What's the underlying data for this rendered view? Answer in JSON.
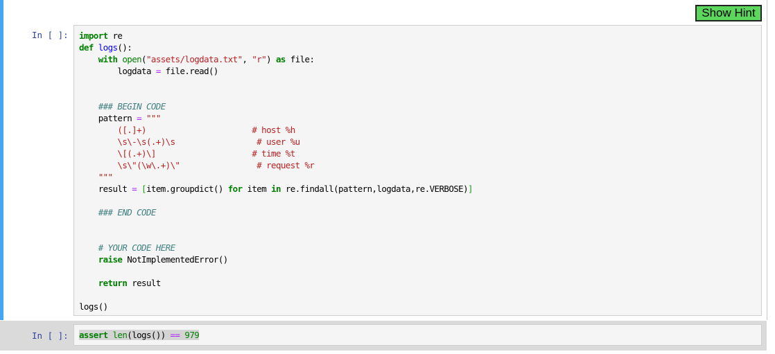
{
  "toolbar": {
    "show_hint_label": "Show Hint"
  },
  "cells": [
    {
      "prompt": "In [ ]:",
      "selected": true,
      "lines": {
        "l1_kw": "import",
        "l1_rest": " re",
        "l2_kw": "def",
        "l2_fn": "logs",
        "l2_rest": "():",
        "l3_kw": "with",
        "l3_bi": "open",
        "l3_p1": "(",
        "l3_s1": "\"assets/logdata.txt\"",
        "l3_p2": ", ",
        "l3_s2": "\"r\"",
        "l3_p3": ") ",
        "l3_kw2": "as",
        "l3_rest": " file:",
        "l4_a": "logdata ",
        "l4_op": "=",
        "l4_b": " file.read()",
        "l7_cm": "### BEGIN CODE",
        "l8_a": "pattern ",
        "l8_op": "=",
        "l8_s": " \"\"\"",
        "l9_s": "    ([.]+)                      # host %h",
        "l10_s": "    \\s\\-\\s(.+)\\s                 # user %u",
        "l11_s": "    \\[(.+)\\]                    # time %t",
        "l12_s": "    \\s\\\"(\\w\\.+)\\\"                # request %r",
        "l13_s": "\"\"\"",
        "l14_a": "result ",
        "l14_op": "=",
        "l14_br1": " [",
        "l14_b": "item.groupdict() ",
        "l14_kw1": "for",
        "l14_c": " item ",
        "l14_kw2": "in",
        "l14_d": " re.findall(pattern,logdata,re.VERBOSE)",
        "l14_br2": "]",
        "l16_cm": "### END CODE",
        "l19_cm": "# YOUR CODE HERE",
        "l20_kw": "raise",
        "l20_rest": " NotImplementedError()",
        "l22_kw": "return",
        "l22_rest": " result",
        "l24": "logs()"
      }
    },
    {
      "prompt": "In [ ]:",
      "selected": false,
      "lines": {
        "kw": "assert",
        "bi": "len",
        "a": "(logs()) ",
        "op": "==",
        "num": " 979"
      }
    }
  ]
}
